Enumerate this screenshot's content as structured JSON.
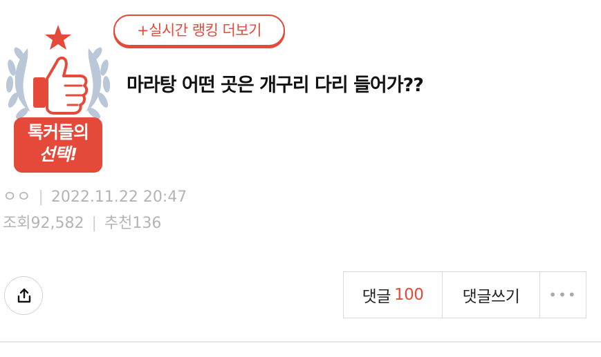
{
  "badge": {
    "line1": "톡커들의",
    "line2": "선택!"
  },
  "ranking_link": {
    "label": "+실시간 랭킹 더보기"
  },
  "post": {
    "title": "마라탕 어떤 곳은 개구리 다리 들어가??",
    "author": "ㅇㅇ",
    "datetime": "2022.11.22 20:47",
    "views_label": "조회",
    "views": "92,582",
    "recommend_label": "추천",
    "recommend": "136"
  },
  "actions": {
    "comments_label": "댓글",
    "comments_count": "100",
    "write_label": "댓글쓰기",
    "more_label": "•••"
  },
  "colors": {
    "accent": "#e5493a",
    "laurel": "#b9c7d8",
    "meta": "#b4b4b4"
  },
  "icons": {
    "share": "share-icon",
    "thumbs_up": "thumbs-up-icon",
    "star": "star-icon",
    "laurel": "laurel-icon"
  }
}
